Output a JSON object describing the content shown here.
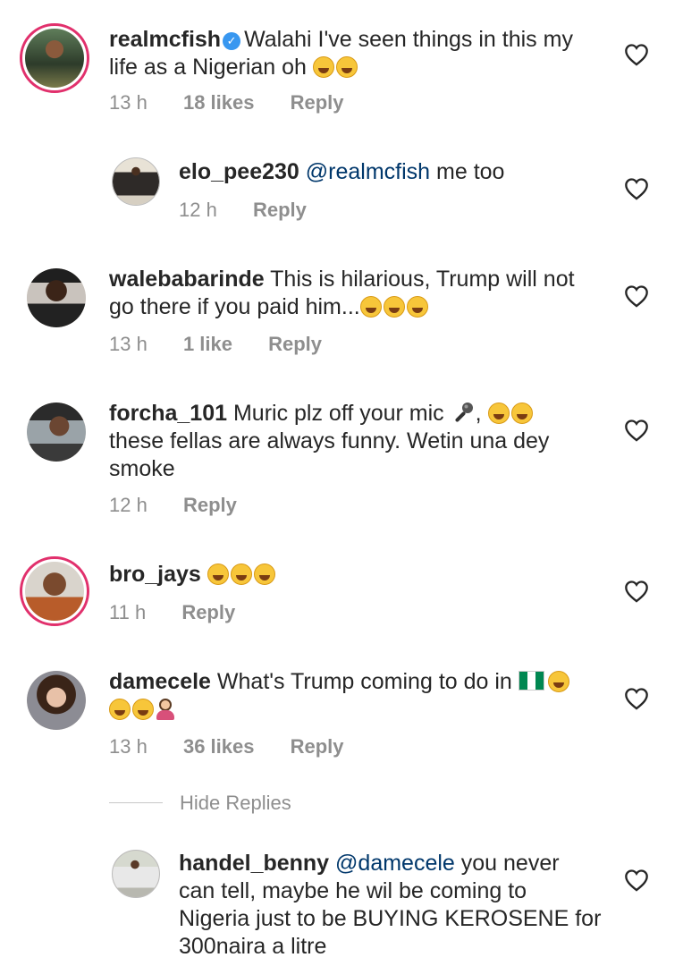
{
  "comments": [
    {
      "username": "realmcfish",
      "text": "Walahi I've seen things in this my",
      "text2": "life as a Nigerian oh",
      "time": "13 h",
      "likes": "18 likes",
      "reply": "Reply"
    },
    {
      "username": "elo_pee230",
      "mention": "@realmcfish",
      "text": " me too",
      "time": "12 h",
      "reply": "Reply"
    },
    {
      "username": "walebabarinde",
      "text": " This is hilarious, Trump will not",
      "text2": "go there if you paid him...",
      "time": "13 h",
      "likes": "1 like",
      "reply": "Reply"
    },
    {
      "username": "forcha_101",
      "text": " Muric plz off your mic",
      "text2": "these fellas are always funny. Wetin una dey",
      "text3": "smoke",
      "time": "12 h",
      "reply": "Reply"
    },
    {
      "username": "bro_jays",
      "time": "11 h",
      "reply": "Reply"
    },
    {
      "username": "damecele",
      "text": " What's Trump coming to do in",
      "time": "13 h",
      "likes": "36 likes",
      "reply": "Reply"
    },
    {
      "username": "handel_benny",
      "mention": "@damecele",
      "text": " you never",
      "text2": "can tell, maybe he wil be coming to",
      "text3": "Nigeria just to be BUYING KEROSENE for",
      "text4": "300naira a litre"
    }
  ],
  "hide_replies": "Hide Replies",
  "icons": {
    "like": "heart-outline-icon",
    "verified": "verified-badge-icon",
    "emoji_laugh": "laughing-emoji",
    "emoji_tears": "tears-of-joy-emoji",
    "flag": "nigeria-flag-emoji",
    "mic": "microphone-emoji",
    "facepalm": "facepalm-emoji"
  },
  "colors": {
    "text": "#262626",
    "meta": "#8e8e8e",
    "mention": "#00376b",
    "verified": "#3897f0",
    "story_ring": "#e1306c"
  }
}
